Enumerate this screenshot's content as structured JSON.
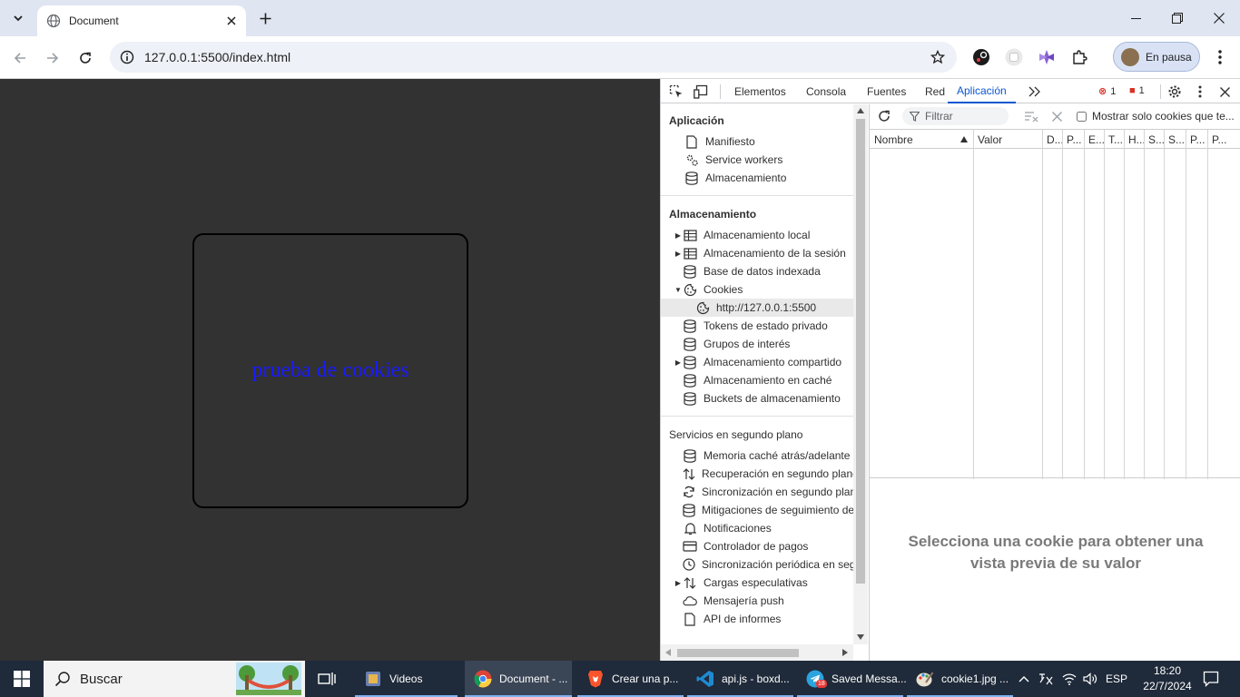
{
  "browser": {
    "tab_title": "Document",
    "url": "127.0.0.1:5500/index.html",
    "profile_label": "En pausa"
  },
  "page": {
    "box_text": "prueba de cookies"
  },
  "devtools": {
    "tabs": [
      "Elementos",
      "Consola",
      "Fuentes",
      "Red",
      "Aplicación"
    ],
    "active_tab": "Aplicación",
    "errors_count": "1",
    "issues_count": "1",
    "sidebar": {
      "app_title": "Aplicación",
      "app_items": [
        "Manifiesto",
        "Service workers",
        "Almacenamiento"
      ],
      "storage_title": "Almacenamiento",
      "storage_items": [
        "Almacenamiento local",
        "Almacenamiento de la sesión",
        "Base de datos indexada",
        "Cookies",
        "http://127.0.0.1:5500",
        "Tokens de estado privado",
        "Grupos de interés",
        "Almacenamiento compartido",
        "Almacenamiento en caché",
        "Buckets de almacenamiento"
      ],
      "bg_title": "Servicios en segundo plano",
      "bg_items": [
        "Memoria caché atrás/adelante",
        "Recuperación en segundo plano",
        "Sincronización en segundo plano",
        "Mitigaciones de seguimiento de rebote",
        "Notificaciones",
        "Controlador de pagos",
        "Sincronización periódica en segundo plano",
        "Cargas especulativas",
        "Mensajería push",
        "API de informes"
      ]
    },
    "cookies": {
      "filter_placeholder": "Filtrar",
      "checkbox_label": "Mostrar solo cookies que te...",
      "columns": [
        "Nombre",
        "Valor",
        "D...",
        "P...",
        "E...",
        "T...",
        "H...",
        "S...",
        "S...",
        "P...",
        "P..."
      ],
      "preview_text": "Selecciona una cookie para obtener una vista previa de su valor"
    }
  },
  "taskbar": {
    "search_text": "Buscar",
    "apps": [
      {
        "label": "Videos",
        "icon": "video-icon"
      },
      {
        "label": "Document - ...",
        "icon": "chrome-icon"
      },
      {
        "label": "Crear una p...",
        "icon": "brave-icon"
      },
      {
        "label": "api.js - boxd...",
        "icon": "vscode-icon"
      },
      {
        "label": "Saved Messa...",
        "icon": "telegram-icon"
      },
      {
        "label": "cookie1.jpg ...",
        "icon": "paint-icon"
      }
    ],
    "telegram_badge": "18",
    "language": "ESP",
    "time": "18:20",
    "date": "22/7/2024"
  },
  "colors": {
    "tabstrip": "#dfe5f1",
    "page_bg": "#323232",
    "link_blue": "#1a1aff",
    "devtools_accent": "#0b57d0",
    "taskbar": "#1f2a3a"
  }
}
